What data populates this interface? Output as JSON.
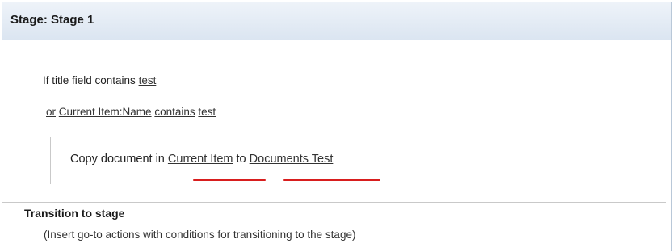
{
  "stage": {
    "title": "Stage: Stage 1"
  },
  "conditions": {
    "first": {
      "prefix": "If title field contains ",
      "value": "test"
    },
    "second": {
      "or": "or",
      "field": "Current Item:Name",
      "operator": "contains",
      "value": "test"
    }
  },
  "action": {
    "prefix": "Copy document in ",
    "source": "Current Item",
    "middle": " to ",
    "destination": "Documents Test"
  },
  "transition": {
    "heading": "Transition to stage",
    "hint": "(Insert go-to actions with conditions for transitioning to the stage)"
  },
  "colors": {
    "header_bg": "#dbe5f1",
    "annotation_red": "#d81e1e"
  }
}
